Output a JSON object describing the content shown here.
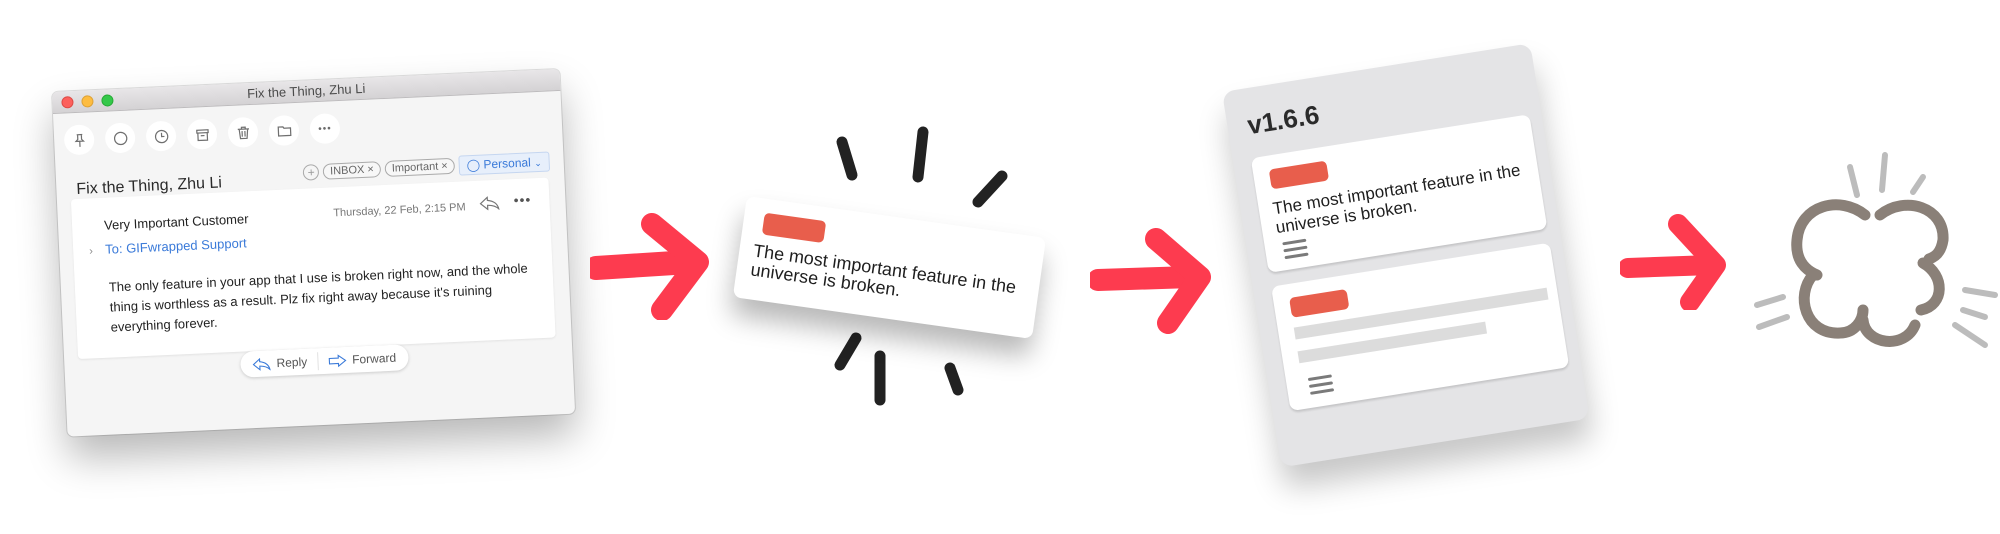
{
  "mail_window": {
    "window_title": "Fix the Thing, Zhu Li",
    "toolbar": [
      {
        "icon": "pin-icon"
      },
      {
        "icon": "circle-icon"
      },
      {
        "icon": "clock-icon"
      },
      {
        "icon": "archive-icon"
      },
      {
        "icon": "trash-icon"
      },
      {
        "icon": "folder-icon"
      },
      {
        "icon": "more-icon",
        "glyph": "•••"
      }
    ],
    "subject": "Fix the Thing, Zhu Li",
    "tags": {
      "add_glyph": "+",
      "items": [
        "INBOX ×",
        "Important ×"
      ],
      "account": "Personal"
    },
    "message": {
      "sender": "Very Important Customer",
      "date": "Thursday, 22 Feb, 2:15 PM",
      "more_glyph": "•••",
      "expand_glyph": "›",
      "recipient": "To: GIFwrapped Support",
      "body": "The only feature in your app that I use is broken right now, and the whole thing is worthless as a result. Plz fix right away because it's ruining everything forever."
    },
    "actions": {
      "reply": "Reply",
      "forward": "Forward"
    }
  },
  "issue_card": {
    "text": "The most important feature in the universe is broken.",
    "label_color": "#e85e4c"
  },
  "board_column": {
    "title": "v1.6.6",
    "cards": [
      {
        "text": "The most important feature in the universe is broken."
      },
      {
        "text": ""
      }
    ]
  },
  "colors": {
    "arrow": "#fd3b4f",
    "label": "#e85e4c",
    "burst": "#222222",
    "explosion": "#8a8078",
    "explosion_lines": "#bcbcbc",
    "link": "#3a7ad9"
  }
}
